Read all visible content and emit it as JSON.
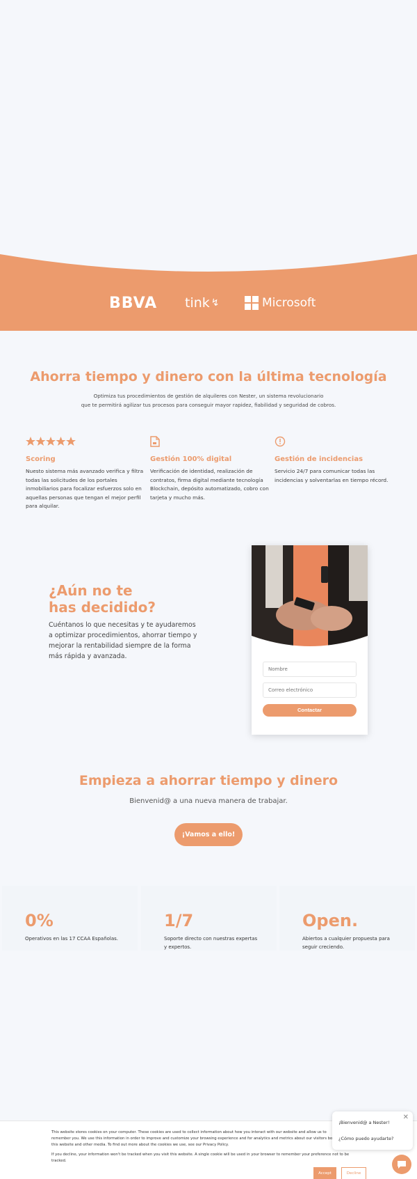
{
  "partners": {
    "bbva": "BBVA",
    "tink": "tink",
    "microsoft": "Microsoft"
  },
  "tech": {
    "title": "Ahorra tiempo y dinero con la última tecnología",
    "subtitle_line1": "Optimiza tus procedimientos de gestión de alquileres con Nester, un sistema revolucionario",
    "subtitle_line2": "que te permitirá agilizar tus procesos para conseguir mayor rapidez, fiabilidad y seguridad de cobros.",
    "features": [
      {
        "icon": "star-rating-icon",
        "title": "Scoring",
        "text": "Nuesto sistema más avanzado verifica y filtra todas las solicitudes de los portales inmobiliarios para focalizar esfuerzos solo en aquellas personas que tengan el mejor perfil para alquilar."
      },
      {
        "icon": "document-icon",
        "title": "Gestión 100% digital",
        "text": "Verificación de identidad, realización de contratos, firma digital mediante tecnología Blockchain, depósito automatizado, cobro con tarjeta y mucho más."
      },
      {
        "icon": "info-icon",
        "title": "Gestión de incidencias",
        "text": "Servicio 24/7 para comunicar todas las incidencias y solventarlas en tiempo récord."
      }
    ]
  },
  "decide": {
    "title_line1": "¿Aún no te",
    "title_line2": "has decidido?",
    "text": "Cuéntanos lo que necesitas y te ayudaremos a optimizar procedimientos, ahorrar tiempo y mejorar la rentabilidad siempre de la forma más rápida y avanzada.",
    "form": {
      "name_placeholder": "Nombre",
      "email_placeholder": "Correo electrónico",
      "submit_label": "Contactar"
    }
  },
  "start": {
    "title": "Empieza a ahorrar tiempo y dinero",
    "subtitle": "Bienvenid@ a una nueva manera de trabajar.",
    "cta_label": "¡Vamos a ello!"
  },
  "stats": [
    {
      "value": "0%",
      "label": "Operativos en las 17 CCAA Españolas."
    },
    {
      "value": "1/7",
      "label": "Soporte directo con nuestras expertas y expertos."
    },
    {
      "value": "Open.",
      "label": "Abiertos a cualquier propuesta para seguir creciendo."
    }
  ],
  "cookies": {
    "text": "This website stores cookies on your computer. These cookies are used to collect information about how you interact with our website and allow us to remember you. We use this information in order to improve and customize your browsing experience and for analytics and metrics about our visitors both on this website and other media. To find out more about the cookies we use, see our Privacy Policy.",
    "text2": "If you decline, your information won't be tracked when you visit this website. A single cookie will be used in your browser to remember your preference not to be tracked.",
    "accept_label": "Accept",
    "decline_label": "Decline"
  },
  "chat": {
    "greeting": "¡Bienvenid@ a Nester!",
    "question": "¿Cómo puedo ayudarte?"
  },
  "colors": {
    "accent": "#ec9b6d",
    "background": "#f5f7fb"
  }
}
